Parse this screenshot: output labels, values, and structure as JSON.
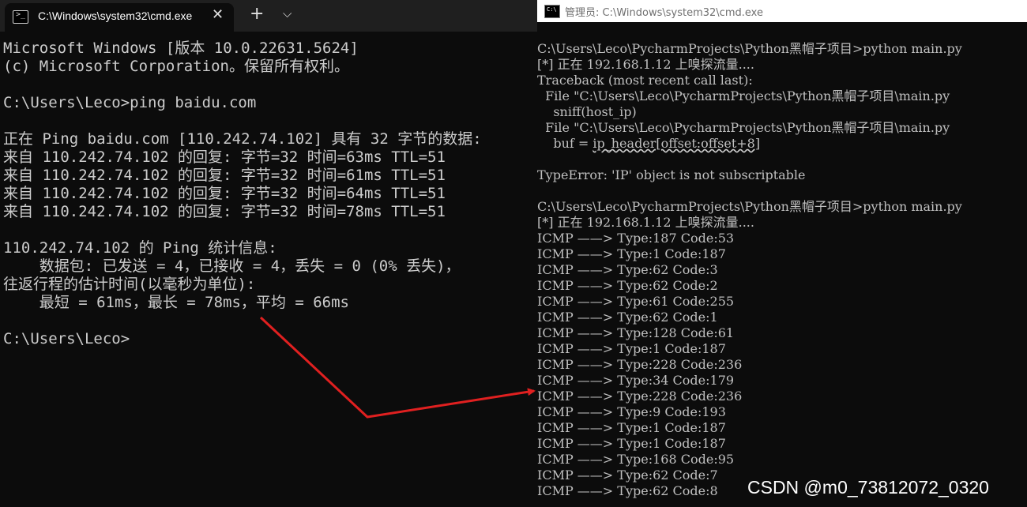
{
  "terminal": {
    "tab_title": "C:\\Windows\\system32\\cmd.exe",
    "lines": [
      "Microsoft Windows [版本 10.0.22631.5624]",
      "(c) Microsoft Corporation。保留所有权利。",
      "",
      "C:\\Users\\Leco>ping baidu.com",
      "",
      "正在 Ping baidu.com [110.242.74.102] 具有 32 字节的数据:",
      "来自 110.242.74.102 的回复: 字节=32 时间=63ms TTL=51",
      "来自 110.242.74.102 的回复: 字节=32 时间=61ms TTL=51",
      "来自 110.242.74.102 的回复: 字节=32 时间=64ms TTL=51",
      "来自 110.242.74.102 的回复: 字节=32 时间=78ms TTL=51",
      "",
      "110.242.74.102 的 Ping 统计信息:",
      "    数据包: 已发送 = 4，已接收 = 4，丢失 = 0 (0% 丢失)，",
      "往返行程的估计时间(以毫秒为单位):",
      "    最短 = 61ms，最长 = 78ms，平均 = 66ms",
      "",
      "C:\\Users\\Leco>"
    ]
  },
  "cmd": {
    "title": "管理员: C:\\Windows\\system32\\cmd.exe",
    "run1": {
      "prompt": "C:\\Users\\Leco\\PycharmProjects\\Python黑帽子项目>python main.py",
      "sniff": "[*] 正在 192.168.1.12 上嗅探流量....",
      "traceback": "Traceback (most recent call last):",
      "file1": "  File \"C:\\Users\\Leco\\PycharmProjects\\Python黑帽子项目\\main.py",
      "code1": "    sniff(host_ip)",
      "file2": "  File \"C:\\Users\\Leco\\PycharmProjects\\Python黑帽子项目\\main.py",
      "code2_prefix": "    buf = ",
      "code2_error": "ip_header[offset:offset+8]",
      "error": "TypeError: 'IP' object is not subscriptable"
    },
    "run2": {
      "prompt": "C:\\Users\\Leco\\PycharmProjects\\Python黑帽子项目>python main.py",
      "sniff": "[*] 正在 192.168.1.12 上嗅探流量....",
      "icmp": [
        "ICMP ——> Type:187 Code:53",
        "ICMP ——> Type:1 Code:187",
        "ICMP ——> Type:62 Code:3",
        "ICMP ——> Type:62 Code:2",
        "ICMP ——> Type:61 Code:255",
        "ICMP ——> Type:62 Code:1",
        "ICMP ——> Type:128 Code:61",
        "ICMP ——> Type:1 Code:187",
        "ICMP ——> Type:228 Code:236",
        "ICMP ——> Type:34 Code:179",
        "ICMP ——> Type:228 Code:236",
        "ICMP ——> Type:9 Code:193",
        "ICMP ——> Type:1 Code:187",
        "ICMP ——> Type:1 Code:187",
        "ICMP ——> Type:168 Code:95",
        "ICMP ——> Type:62 Code:7",
        "ICMP ——> Type:62 Code:8"
      ]
    }
  },
  "watermark": "CSDN @m0_73812072_0320",
  "colors": {
    "terminal_text": "#cccccc",
    "cmd_text": "#c0c0c0",
    "arrow": "#e02020"
  },
  "icons": {
    "terminal_tab": "terminal-icon",
    "cmd_window": "cmd-icon"
  }
}
